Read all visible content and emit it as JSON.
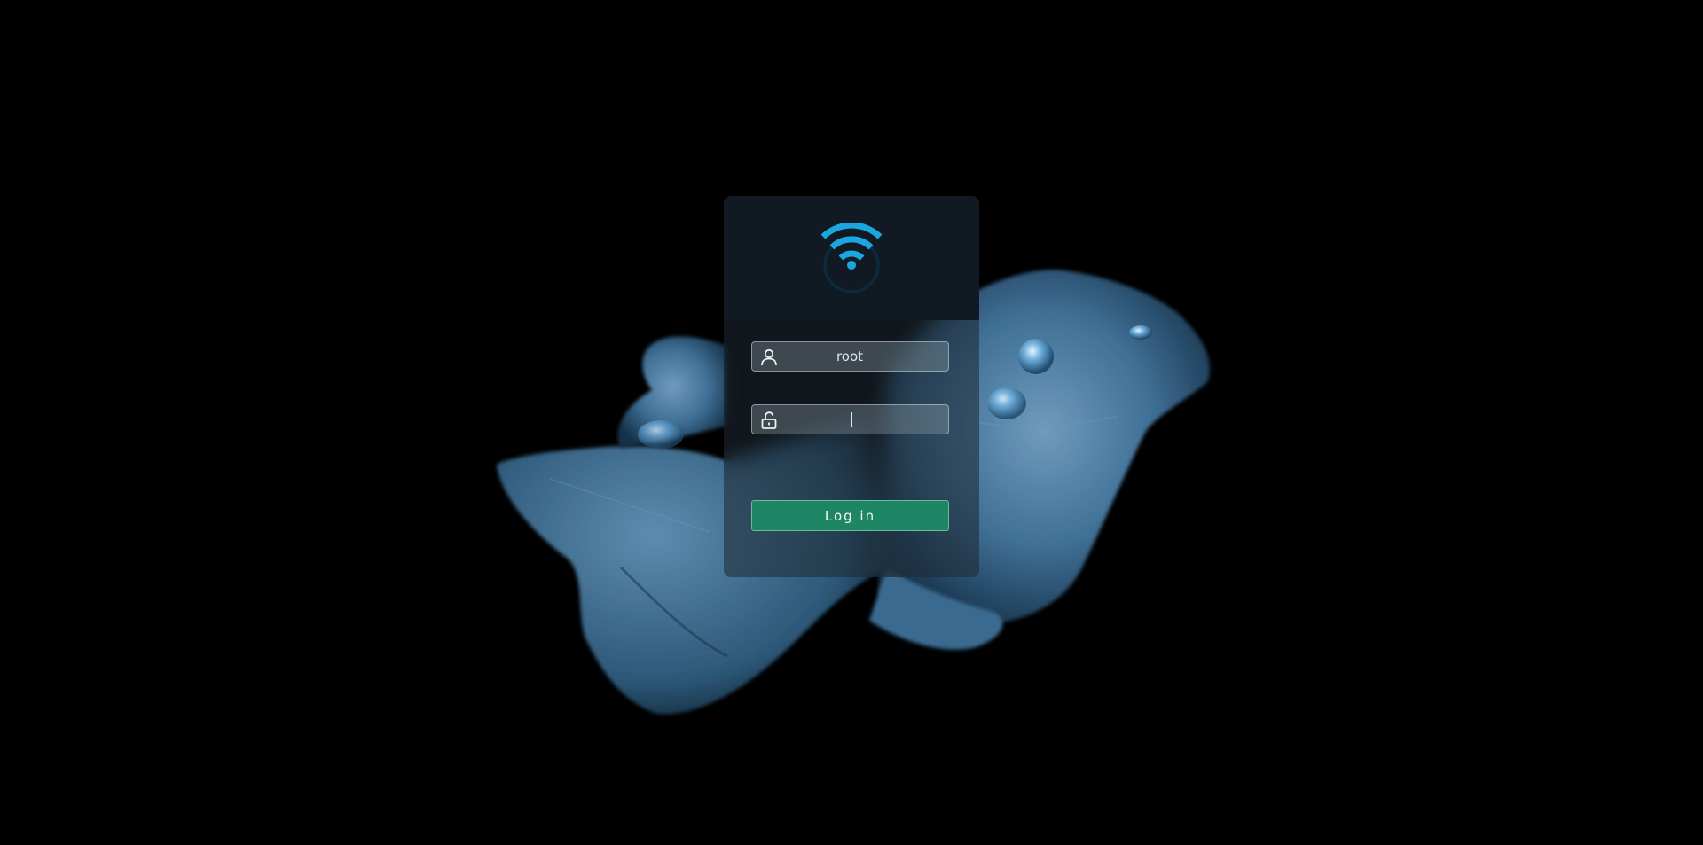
{
  "colors": {
    "background": "#000000",
    "accent_wifi": "#1aa7e0",
    "login_button": "#1e8664",
    "petal": "#4a7fa8"
  },
  "logo": {
    "icon": "wifi-logo-icon"
  },
  "login": {
    "username": {
      "icon": "user-icon",
      "value": "root"
    },
    "password": {
      "icon": "unlock-icon",
      "value": ""
    },
    "button_label": "Log in"
  }
}
